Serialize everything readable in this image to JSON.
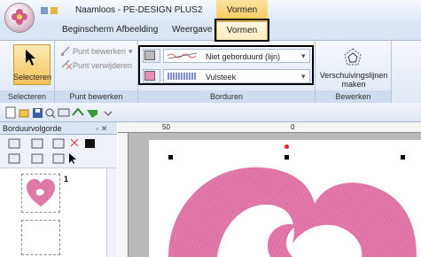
{
  "window": {
    "title": "Naamloos - PE-DESIGN PLUS2",
    "context_tab": "Vormen"
  },
  "tabs": [
    "Beginscherm",
    "Afbeelding",
    "Weergave",
    "Vormen"
  ],
  "ribbon": {
    "selecteren": {
      "button_label": "Selecteren",
      "group_label": "Selecteren"
    },
    "punt_bewerken": {
      "edit_point": "Punt bewerken",
      "delete_point": "Punt verwijderen",
      "group_label": "Punt bewerken"
    },
    "borduren": {
      "line_stitch": "Niet geborduurd (lijn)",
      "fill_stitch": "Vulsteek",
      "group_label": "Borduren",
      "line_color": "#b8b8b8",
      "fill_color": "#e88bb5"
    },
    "bewerken": {
      "move_lines_label_1": "Verschuivingslijnen",
      "move_lines_label_2": "maken",
      "group_label": "Bewerken"
    }
  },
  "panel": {
    "title": "Borduurvolgorde",
    "pin": "▫ ✕",
    "order_number": "1"
  },
  "ruler": {
    "mark_50": "50",
    "mark_0": "0"
  },
  "colors": {
    "design_pink": "#e078a8",
    "accent_tab": "#f8c65a"
  }
}
